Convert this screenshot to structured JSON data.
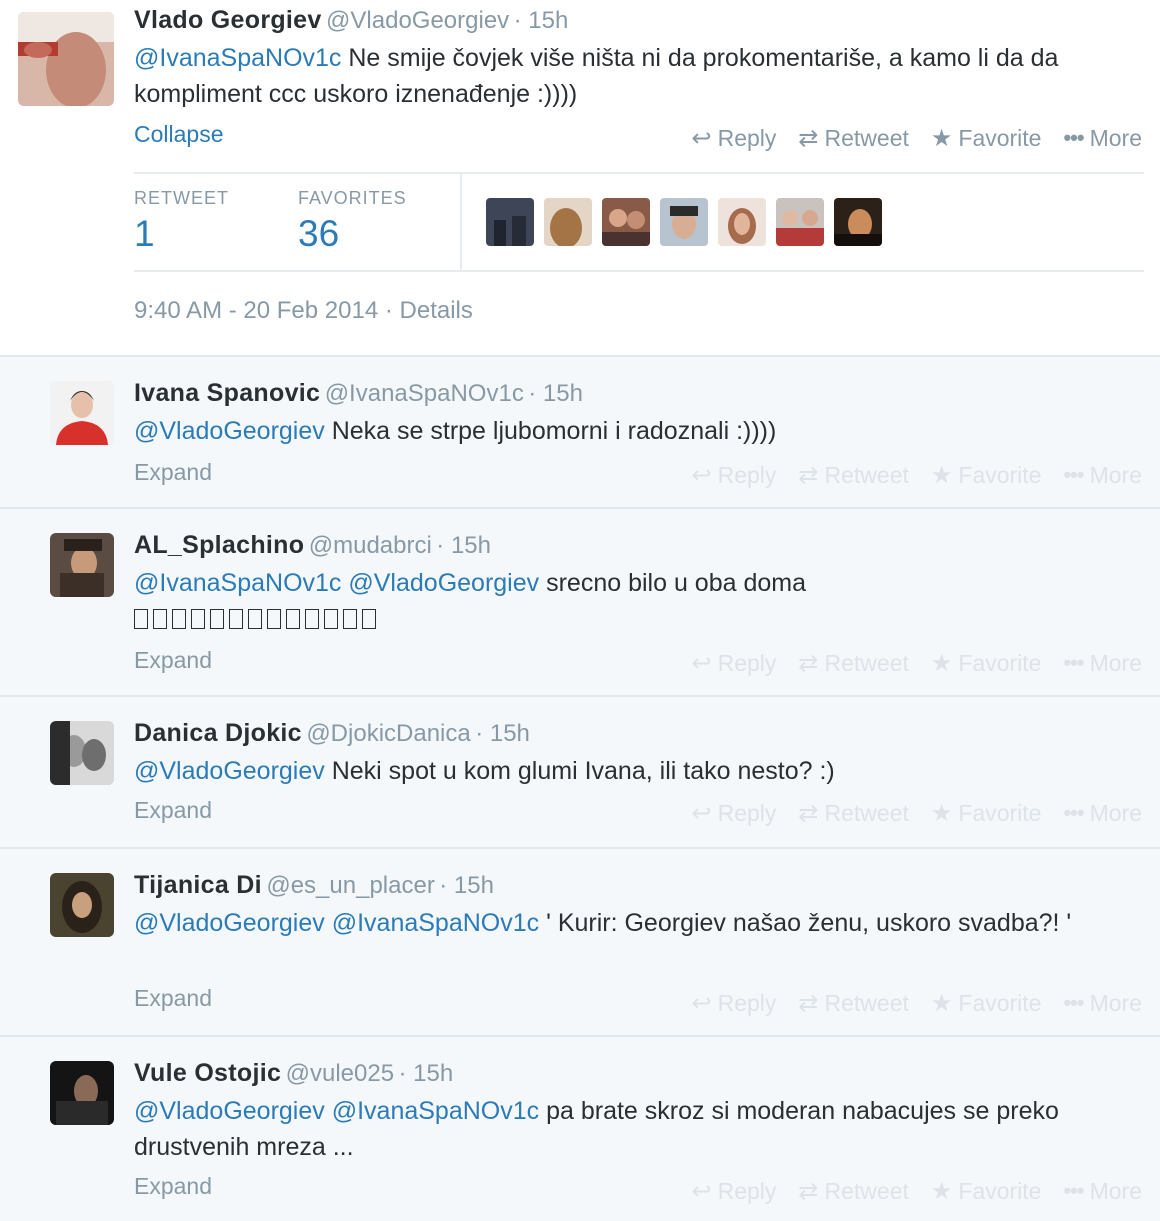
{
  "main_tweet": {
    "name": "Vlado Georgiev",
    "handle": "@VladoGeorgiev",
    "time": "· 15h",
    "mention": "@IvanaSpaNOv1c",
    "text": "Ne smije čovjek više ništa ni da prokomentariše, a kamo li da da kompliment ccc uskoro iznenađenje :))))",
    "collapse_label": "Collapse",
    "actions": {
      "reply": "Reply",
      "retweet": "Retweet",
      "favorite": "Favorite",
      "more": "More"
    },
    "stats": {
      "retweet_label": "RETWEET",
      "retweet_count": "1",
      "favorites_label": "FAVORITES",
      "favorites_count": "36"
    },
    "timestamp": "9:40 AM - 20 Feb 2014",
    "details_label": "Details"
  },
  "replies": [
    {
      "name": "Ivana Spanovic",
      "handle": "@IvanaSpaNOv1c",
      "time": "· 15h",
      "mentions": [
        "@VladoGeorgiev"
      ],
      "text": "Neka se strpe ljubomorni i radoznali :))))",
      "expand_label": "Expand"
    },
    {
      "name": "AL_Splachino",
      "handle": "@mudabrci",
      "time": "· 15h",
      "mentions": [
        "@IvanaSpaNOv1c",
        "@VladoGeorgiev"
      ],
      "text": "srecno bilo u oba doma",
      "tofu_count": 13,
      "expand_label": "Expand"
    },
    {
      "name": "Danica Djokic",
      "handle": "@DjokicDanica",
      "time": "· 15h",
      "mentions": [
        "@VladoGeorgiev"
      ],
      "text": "Neki spot u kom glumi Ivana, ili tako nesto? :)",
      "expand_label": "Expand"
    },
    {
      "name": "Tijanica Di",
      "handle": "@es_un_placer",
      "time": "· 15h",
      "mentions": [
        "@VladoGeorgiev",
        "@IvanaSpaNOv1c"
      ],
      "text": "' Kurir: Georgiev našao ženu, uskoro svadba?! '",
      "expand_label": "Expand"
    },
    {
      "name": "Vule Ostojic",
      "handle": "@vule025",
      "time": "· 15h",
      "mentions": [
        "@VladoGeorgiev",
        "@IvanaSpaNOv1c"
      ],
      "text": "pa brate skroz si moderan nabacujes se preko drustvenih mreza ...",
      "expand_label": "Expand"
    }
  ],
  "reply_actions": {
    "reply": "Reply",
    "retweet": "Retweet",
    "favorite": "Favorite",
    "more": "More"
  },
  "icons": {
    "reply": "reply-arrow-icon",
    "retweet": "retweet-icon",
    "favorite": "star-icon",
    "more": "more-dots-icon"
  },
  "colors": {
    "link": "#2b7bb9",
    "muted": "#8899a6",
    "text": "#292f33",
    "reply_bg": "#f5f8fa",
    "divider": "#e1e8ed"
  }
}
